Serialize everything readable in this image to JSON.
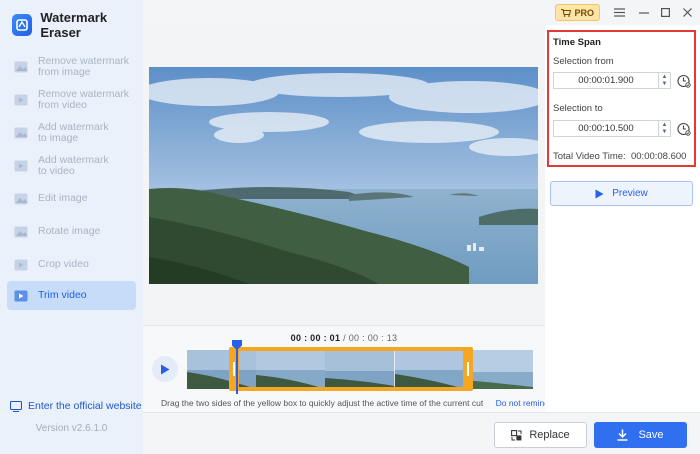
{
  "app": {
    "title": "Watermark Eraser",
    "version": "Version v2.6.1.0",
    "official_link": "Enter the official website"
  },
  "sidebar": {
    "items": [
      {
        "label": "Remove watermark\nfrom image",
        "icon": "image-icon",
        "active": false
      },
      {
        "label": "Remove watermark\nfrom video",
        "icon": "video-icon",
        "active": false
      },
      {
        "label": "Add watermark\nto image",
        "icon": "image-icon",
        "active": false
      },
      {
        "label": "Add watermark\nto video",
        "icon": "video-icon",
        "active": false
      },
      {
        "label": "Edit image",
        "icon": "image-icon",
        "active": false
      },
      {
        "label": "Rotate image",
        "icon": "image-icon",
        "active": false
      },
      {
        "label": "Crop video",
        "icon": "video-icon",
        "active": false
      },
      {
        "label": "Trim video",
        "icon": "video-icon",
        "active": true
      }
    ]
  },
  "topbar": {
    "pro_label": "PRO"
  },
  "timeline": {
    "current_time": "00 : 00 : 01",
    "separator": " / ",
    "total_time": "00 : 00 : 13",
    "hint": "Drag the two sides of the yellow box to quickly adjust the active time of the current cut",
    "hint_link": "Do not remind again",
    "selection_start_fraction": 0.13,
    "selection_end_fraction": 0.81,
    "playhead_fraction": 0.15
  },
  "time_span": {
    "title": "Time Span",
    "from_label": "Selection from",
    "from_value": "00:00:01.900",
    "to_label": "Selection to",
    "to_value": "00:00:10.500",
    "total_label": "Total Video Time:",
    "total_value": "00:00:08.600"
  },
  "buttons": {
    "preview": "Preview",
    "replace": "Replace",
    "save": "Save"
  },
  "colors": {
    "accent": "#2f6ff0",
    "selection": "#f5a623",
    "highlight_border": "#e53935",
    "sidebar_bg": "#eaf1fb"
  }
}
